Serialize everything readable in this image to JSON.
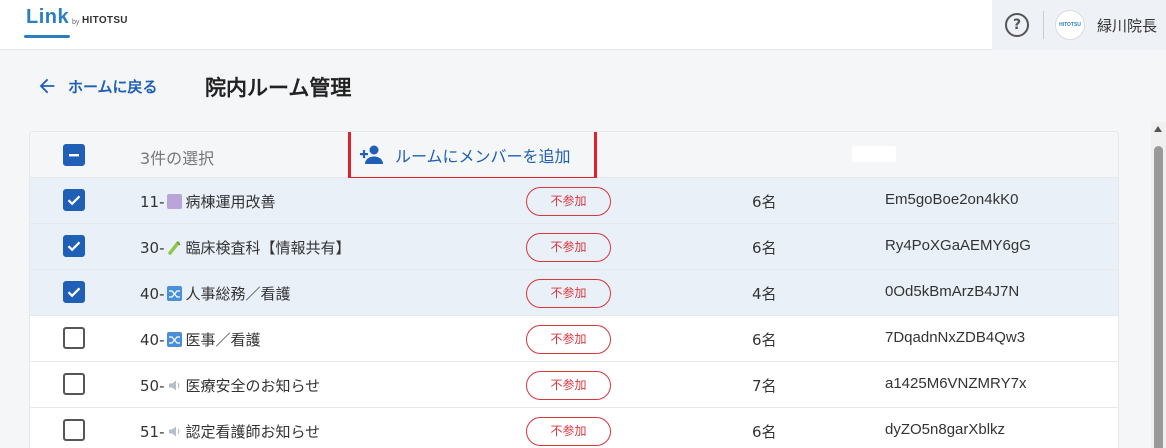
{
  "header": {
    "logo_text": "Link",
    "logo_by": "by",
    "logo_brand": "HITOTSU",
    "avatar_text": "HITOTSU",
    "username": "緑川院長"
  },
  "nav": {
    "back_label": "ホームに戻る",
    "page_title": "院内ルーム管理"
  },
  "toolbar": {
    "selected_count_label": "3件の選択",
    "add_member_label": "ルームにメンバーを追加"
  },
  "rooms": [
    {
      "selected": true,
      "prefix": "11-",
      "icon": "purple-book-icon",
      "name": "病棟運用改善",
      "status": "不参加",
      "members": "6名",
      "id": "Em5goBoe2on4kK0"
    },
    {
      "selected": true,
      "prefix": "30-",
      "icon": "test-tube-icon",
      "name": "臨床検査科【情報共有】",
      "status": "不参加",
      "members": "6名",
      "id": "Ry4PoXGaAEMY6gG"
    },
    {
      "selected": true,
      "prefix": "40-",
      "icon": "shuffle-icon",
      "name": "人事総務／看護",
      "status": "不参加",
      "members": "4名",
      "id": "0Od5kBmArzB4J7N"
    },
    {
      "selected": false,
      "prefix": "40-",
      "icon": "shuffle-icon",
      "name": "医事／看護",
      "status": "不参加",
      "members": "6名",
      "id": "7DqadnNxZDB4Qw3"
    },
    {
      "selected": false,
      "prefix": "50-",
      "icon": "speaker-icon",
      "name": "医療安全のお知らせ",
      "status": "不参加",
      "members": "7名",
      "id": "a1425M6VNZMRY7x"
    },
    {
      "selected": false,
      "prefix": "51-",
      "icon": "speaker-icon",
      "name": "認定看護師お知らせ",
      "status": "不参加",
      "members": "6名",
      "id": "dyZO5n8garXblkz"
    }
  ],
  "colors": {
    "accent": "#1f5fb5",
    "highlight_box": "#e0212b",
    "status_red": "#d9363e",
    "selected_row": "#eaf0f8"
  }
}
